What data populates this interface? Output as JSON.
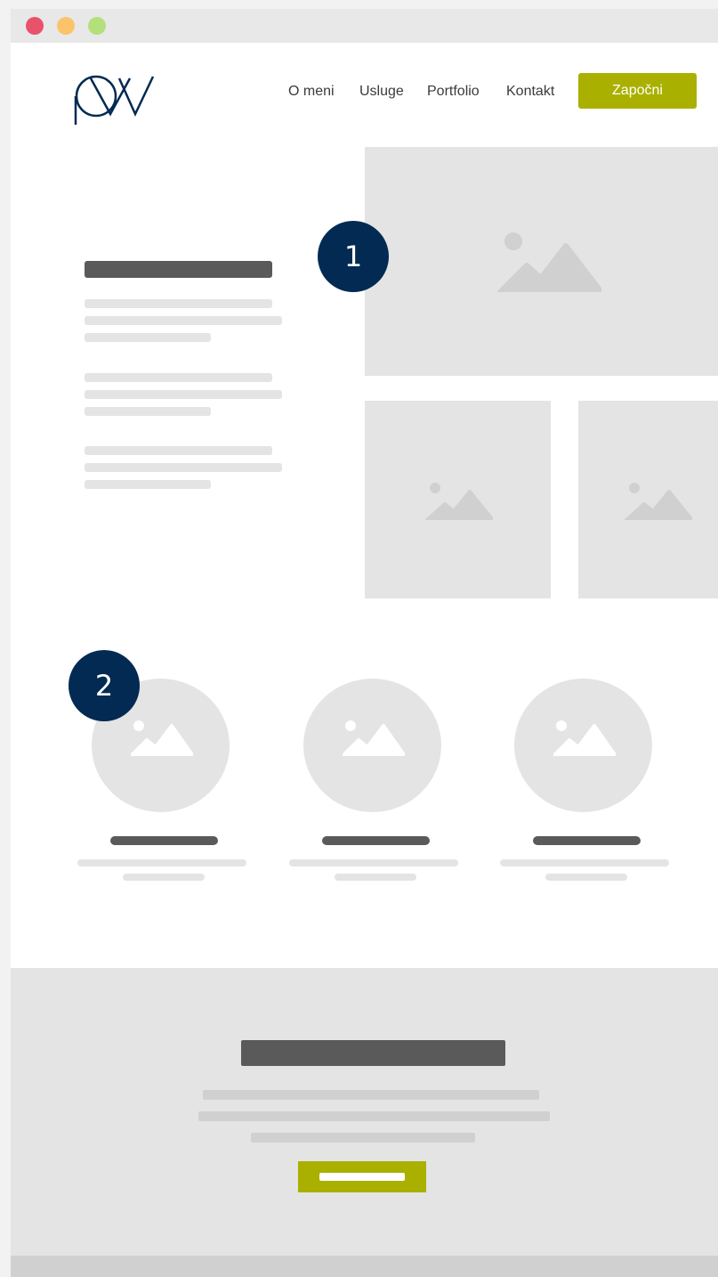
{
  "nav": {
    "items": [
      {
        "label": "O meni"
      },
      {
        "label": "Usluge"
      },
      {
        "label": "Portfolio"
      },
      {
        "label": "Kontakt"
      }
    ],
    "cta_label": "Započni"
  },
  "badges": {
    "one": "1",
    "two": "2"
  },
  "colors": {
    "accent": "#aab000",
    "navy": "#022a52",
    "placeholder": "#e4e4e4",
    "text_bar": "#5a5a5a"
  },
  "icons": {
    "logo": "pw-logo",
    "image": "image-placeholder-icon"
  }
}
